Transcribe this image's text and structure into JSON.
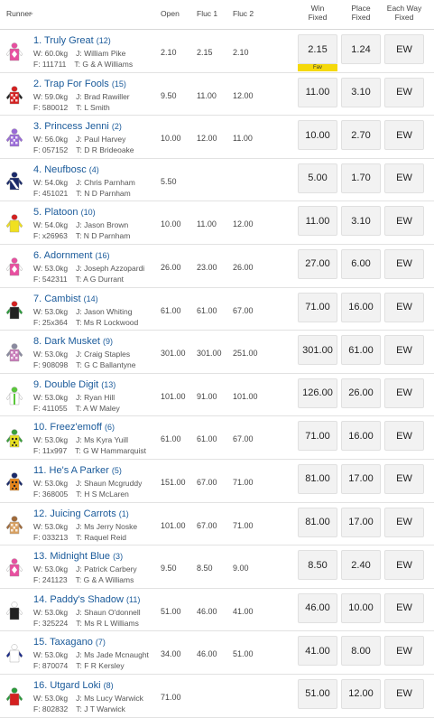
{
  "header": {
    "runner": "Runner",
    "sort": "⌄",
    "open": "Open",
    "fluc1": "Fluc 1",
    "fluc2": "Fluc 2",
    "win_fixed": "Win\nFixed",
    "place_fixed": "Place\nFixed",
    "each_way_fixed": "Each Way\nFixed"
  },
  "ew_label": "EW",
  "fav_label": "Fav",
  "runners": [
    {
      "name": "1. Truly Great",
      "barrier": "(12)",
      "weight": "W: 60.0kg",
      "jockey": "J: William Pike",
      "form": "F: 111711",
      "trainer": "T: G & A Williams",
      "open": "2.10",
      "fluc1": "2.15",
      "fluc2": "2.10",
      "win": "2.15",
      "place": "1.24",
      "fav": true,
      "silk": {
        "body": "#e84fa0",
        "sleeve": "#ffffff",
        "cap": "#e84fa0",
        "pattern": "diamond"
      }
    },
    {
      "name": "2. Trap For Fools",
      "barrier": "(15)",
      "weight": "W: 59.0kg",
      "jockey": "J: Brad Rawiller",
      "form": "F: 580012",
      "trainer": "T: L Smith",
      "open": "9.50",
      "fluc1": "11.00",
      "fluc2": "12.00",
      "win": "11.00",
      "place": "3.10",
      "fav": false,
      "silk": {
        "body": "#d42020",
        "sleeve": "#222222",
        "cap": "#d42020",
        "pattern": "check"
      }
    },
    {
      "name": "3. Princess Jenni",
      "barrier": "(2)",
      "weight": "W: 56.0kg",
      "jockey": "J: Paul Harvey",
      "form": "F: 057152",
      "trainer": "T: D R Brideoake",
      "open": "10.00",
      "fluc1": "12.00",
      "fluc2": "11.00",
      "win": "10.00",
      "place": "2.70",
      "fav": false,
      "silk": {
        "body": "#9a6ad8",
        "sleeve": "#9a6ad8",
        "cap": "#9a6ad8",
        "pattern": "check"
      }
    },
    {
      "name": "4. Neufbosc",
      "barrier": "(4)",
      "weight": "W: 54.0kg",
      "jockey": "J: Chris Parnham",
      "form": "F: 451021",
      "trainer": "T: N D Parnham",
      "open": "5.50",
      "fluc1": "",
      "fluc2": "",
      "win": "5.00",
      "place": "1.70",
      "fav": false,
      "silk": {
        "body": "#1a2a6a",
        "sleeve": "#1a2a6a",
        "cap": "#1a2a6a",
        "pattern": "sash"
      }
    },
    {
      "name": "5. Platoon",
      "barrier": "(10)",
      "weight": "W: 54.0kg",
      "jockey": "J: Jason Brown",
      "form": "F: x26963",
      "trainer": "T: N D Parnham",
      "open": "10.00",
      "fluc1": "11.00",
      "fluc2": "12.00",
      "win": "11.00",
      "place": "3.10",
      "fav": false,
      "silk": {
        "body": "#f0e020",
        "sleeve": "#f0e020",
        "cap": "#d42020",
        "pattern": "plain"
      }
    },
    {
      "name": "6. Adornment",
      "barrier": "(16)",
      "weight": "W: 53.0kg",
      "jockey": "J: Joseph Azzopardi",
      "form": "F: 542311",
      "trainer": "T: A G Durrant",
      "open": "26.00",
      "fluc1": "23.00",
      "fluc2": "26.00",
      "win": "27.00",
      "place": "6.00",
      "fav": false,
      "silk": {
        "body": "#e84fa0",
        "sleeve": "#ffffff",
        "cap": "#e84fa0",
        "pattern": "diamond"
      }
    },
    {
      "name": "7. Cambist",
      "barrier": "(14)",
      "weight": "W: 53.0kg",
      "jockey": "J: Jason Whiting",
      "form": "F: 25x364",
      "trainer": "T: Ms R Lockwood",
      "open": "61.00",
      "fluc1": "61.00",
      "fluc2": "67.00",
      "win": "71.00",
      "place": "16.00",
      "fav": false,
      "silk": {
        "body": "#222222",
        "sleeve": "#2a9a3a",
        "cap": "#d42020",
        "pattern": "plain"
      }
    },
    {
      "name": "8. Dark Musket",
      "barrier": "(9)",
      "weight": "W: 53.0kg",
      "jockey": "J: Craig Staples",
      "form": "F: 908098",
      "trainer": "T: G C Ballantyne",
      "open": "301.00",
      "fluc1": "301.00",
      "fluc2": "251.00",
      "win": "301.00",
      "place": "61.00",
      "fav": false,
      "silk": {
        "body": "#c77ab8",
        "sleeve": "#8a8aa0",
        "cap": "#8a8aa0",
        "pattern": "check"
      }
    },
    {
      "name": "9. Double Digit",
      "barrier": "(13)",
      "weight": "W: 53.0kg",
      "jockey": "J: Ryan Hill",
      "form": "F: 411055",
      "trainer": "T: A W Maley",
      "open": "101.00",
      "fluc1": "91.00",
      "fluc2": "101.00",
      "win": "126.00",
      "place": "26.00",
      "fav": false,
      "silk": {
        "body": "#ffffff",
        "sleeve": "#ffffff",
        "cap": "#5ac83a",
        "pattern": "stripe"
      }
    },
    {
      "name": "10. Freez'emoff",
      "barrier": "(6)",
      "weight": "W: 53.0kg",
      "jockey": "J: Ms Kyra Yuill",
      "form": "F: 11x997",
      "trainer": "T: G W Hammarquist",
      "open": "61.00",
      "fluc1": "61.00",
      "fluc2": "67.00",
      "win": "71.00",
      "place": "16.00",
      "fav": false,
      "silk": {
        "body": "#e8e020",
        "sleeve": "#3aa03a",
        "cap": "#3aa03a",
        "pattern": "spots"
      }
    },
    {
      "name": "11. He's A Parker",
      "barrier": "(5)",
      "weight": "W: 53.0kg",
      "jockey": "J: Shaun Mcgruddy",
      "form": "F: 368005",
      "trainer": "T: H S McLaren",
      "open": "151.00",
      "fluc1": "67.00",
      "fluc2": "71.00",
      "win": "81.00",
      "place": "17.00",
      "fav": false,
      "silk": {
        "body": "#e8861a",
        "sleeve": "#1a2a6a",
        "cap": "#1a2a6a",
        "pattern": "spots"
      }
    },
    {
      "name": "12. Juicing Carrots",
      "barrier": "(1)",
      "weight": "W: 53.0kg",
      "jockey": "J: Ms Jerry Noske",
      "form": "F: 033213",
      "trainer": "T: Raquel Reid",
      "open": "101.00",
      "fluc1": "67.00",
      "fluc2": "71.00",
      "win": "81.00",
      "place": "17.00",
      "fav": false,
      "silk": {
        "body": "#d8a060",
        "sleeve": "#a06a3a",
        "cap": "#a06a3a",
        "pattern": "check"
      }
    },
    {
      "name": "13. Midnight Blue",
      "barrier": "(3)",
      "weight": "W: 53.0kg",
      "jockey": "J: Patrick Carbery",
      "form": "F: 241123",
      "trainer": "T: G & A Williams",
      "open": "9.50",
      "fluc1": "8.50",
      "fluc2": "9.00",
      "win": "8.50",
      "place": "2.40",
      "fav": false,
      "silk": {
        "body": "#e84fa0",
        "sleeve": "#ffffff",
        "cap": "#e84fa0",
        "pattern": "diamond"
      }
    },
    {
      "name": "14. Paddy's Shadow",
      "barrier": "(11)",
      "weight": "W: 53.0kg",
      "jockey": "J: Shaun O'donnell",
      "form": "F: 325224",
      "trainer": "T: Ms R L Williams",
      "open": "51.00",
      "fluc1": "46.00",
      "fluc2": "41.00",
      "win": "46.00",
      "place": "10.00",
      "fav": false,
      "silk": {
        "body": "#222222",
        "sleeve": "#ffffff",
        "cap": "#ffffff",
        "pattern": "plain"
      }
    },
    {
      "name": "15. Taxagano",
      "barrier": "(7)",
      "weight": "W: 53.0kg",
      "jockey": "J: Ms Jade Mcnaught",
      "form": "F: 870074",
      "trainer": "T: F R Kersley",
      "open": "34.00",
      "fluc1": "46.00",
      "fluc2": "51.00",
      "win": "41.00",
      "place": "8.00",
      "fav": false,
      "silk": {
        "body": "#ffffff",
        "sleeve": "#1a2a8a",
        "cap": "#ffffff",
        "pattern": "sash"
      }
    },
    {
      "name": "16. Utgard Loki",
      "barrier": "(8)",
      "weight": "W: 53.0kg",
      "jockey": "J: Ms Lucy Warwick",
      "form": "F: 802832",
      "trainer": "T: J T Warwick",
      "open": "71.00",
      "fluc1": "",
      "fluc2": "",
      "win": "51.00",
      "place": "12.00",
      "fav": false,
      "silk": {
        "body": "#d42020",
        "sleeve": "#2a9a3a",
        "cap": "#2a9a3a",
        "pattern": "plain"
      }
    }
  ]
}
